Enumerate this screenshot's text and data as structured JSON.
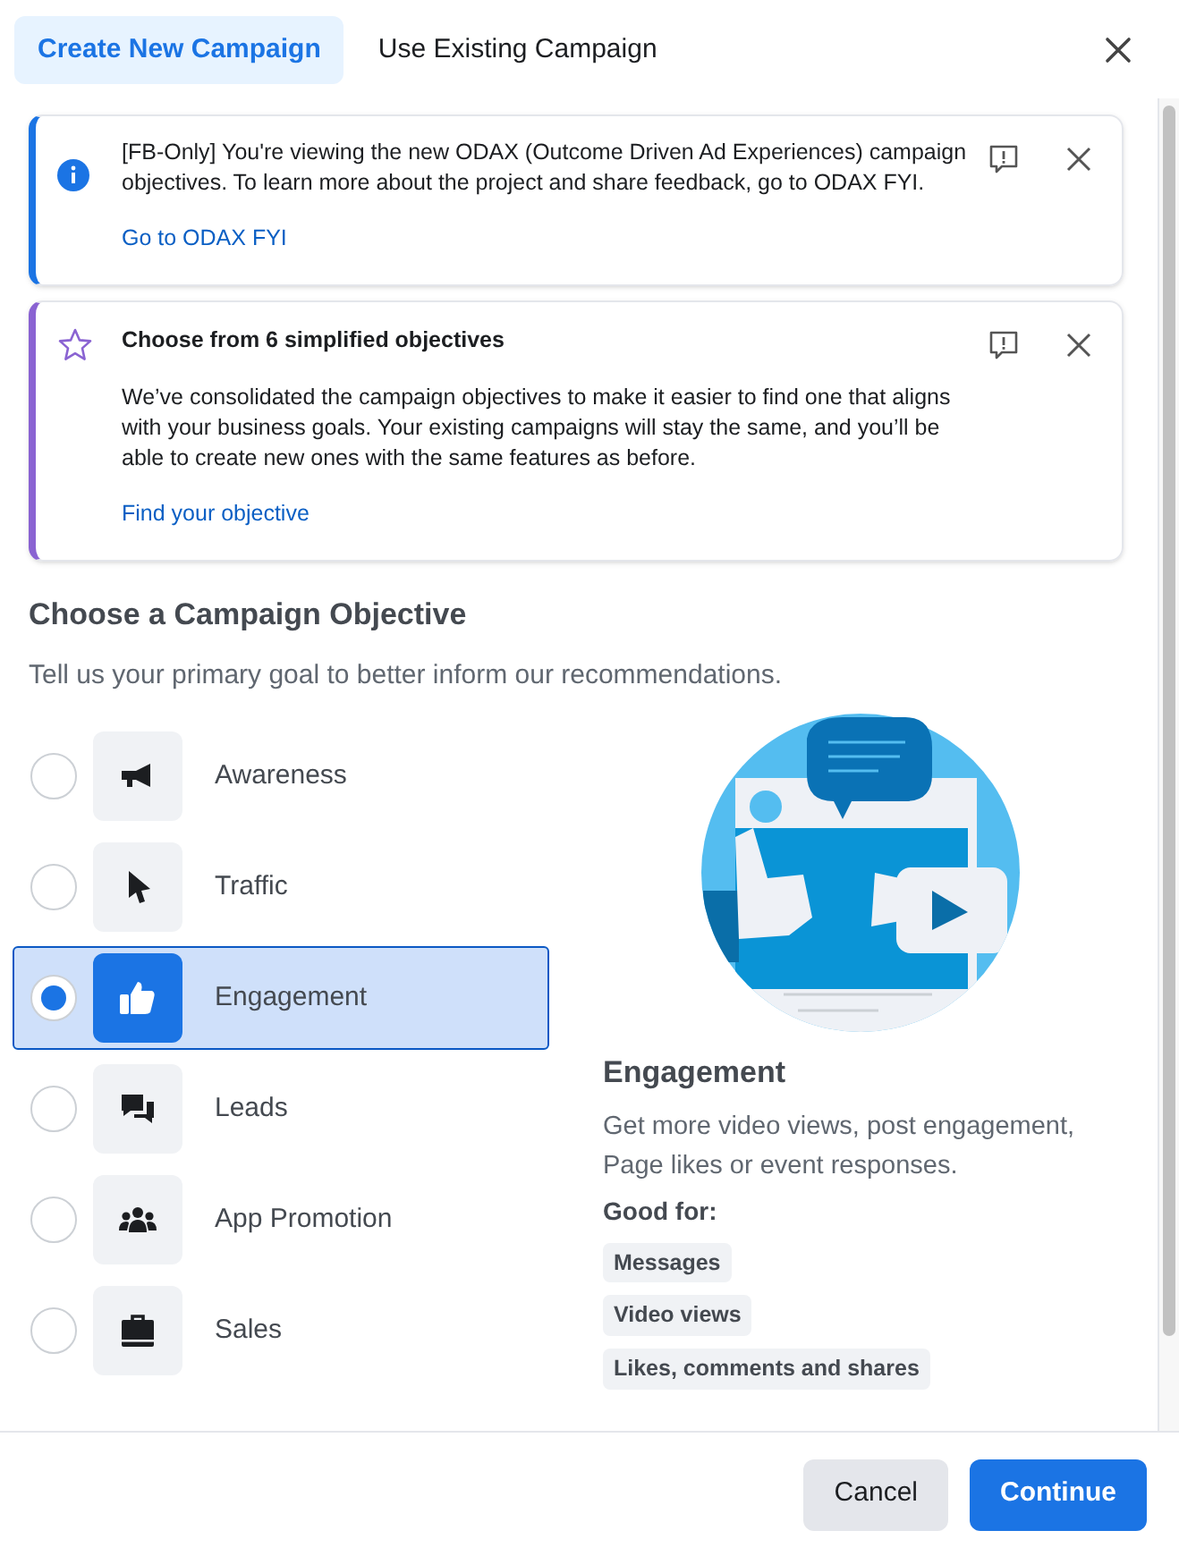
{
  "tabs": [
    {
      "label": "Create New Campaign",
      "selected": true
    },
    {
      "label": "Use Existing Campaign",
      "selected": false
    }
  ],
  "notices": [
    {
      "kind": "info",
      "color": "#1b74e4",
      "text": "[FB-Only] You're viewing the new ODAX (Outcome Driven Ad Experiences) campaign objectives. To learn more about the project and share feedback, go to ODAX FYI.",
      "link": "Go to ODAX FYI"
    },
    {
      "kind": "star",
      "color": "#8a63d2",
      "title": "Choose from 6 simplified objectives",
      "text": "We’ve consolidated the campaign objectives to make it easier to find one that aligns with your business goals. Your existing campaigns will stay the same, and you’ll be able to create new ones with the same features as before.",
      "link": "Find your objective"
    }
  ],
  "section": {
    "title": "Choose a Campaign Objective",
    "subtitle": "Tell us your primary goal to better inform our recommendations."
  },
  "objectives": [
    {
      "label": "Awareness",
      "selected": false
    },
    {
      "label": "Traffic",
      "selected": false
    },
    {
      "label": "Engagement",
      "selected": true
    },
    {
      "label": "Leads",
      "selected": false
    },
    {
      "label": "App Promotion",
      "selected": false
    },
    {
      "label": "Sales",
      "selected": false
    }
  ],
  "detail": {
    "title": "Engagement",
    "description": "Get more video views, post engagement, Page likes or event responses.",
    "good_for_label": "Good for:",
    "tags": [
      "Messages",
      "Video views",
      "Likes, comments and shares"
    ]
  },
  "footer": {
    "buttons": [
      "Cancel",
      "Continue"
    ]
  }
}
